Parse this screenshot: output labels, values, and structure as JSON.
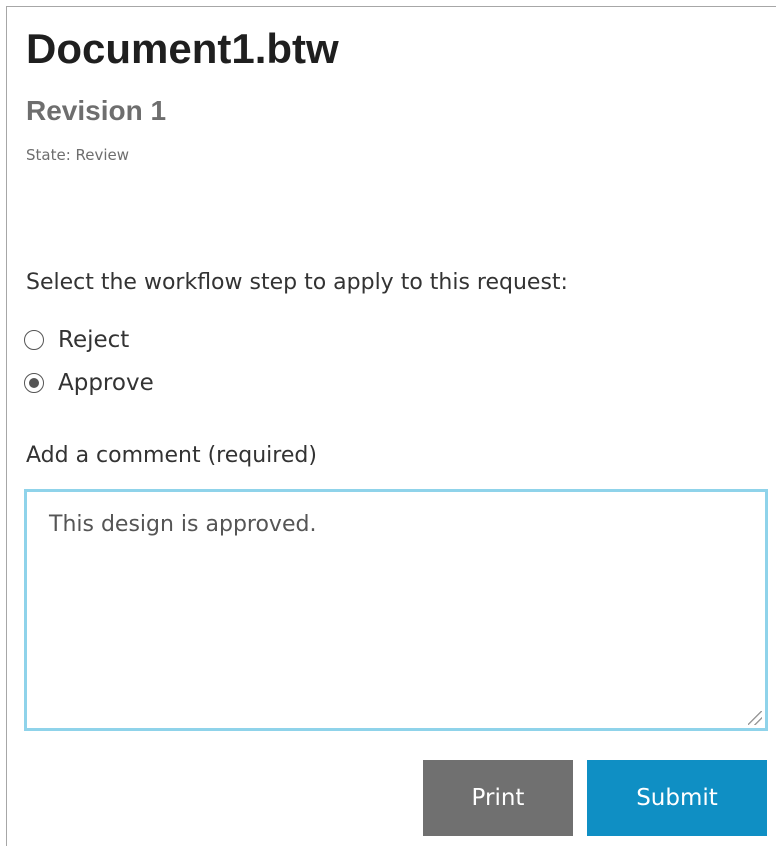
{
  "document": {
    "title": "Document1.btw",
    "revision": "Revision 1",
    "state": "State: Review"
  },
  "workflow": {
    "prompt": "Select the workflow step to apply to this request:",
    "options": [
      {
        "label": "Reject",
        "selected": false
      },
      {
        "label": "Approve",
        "selected": true
      }
    ]
  },
  "comment": {
    "label": "Add a comment (required)",
    "value": "This design is approved."
  },
  "actions": {
    "print_label": "Print",
    "submit_label": "Submit"
  },
  "colors": {
    "print_button": "#707070",
    "submit_button": "#0f8fc4",
    "comment_border": "#8fd3ea"
  }
}
